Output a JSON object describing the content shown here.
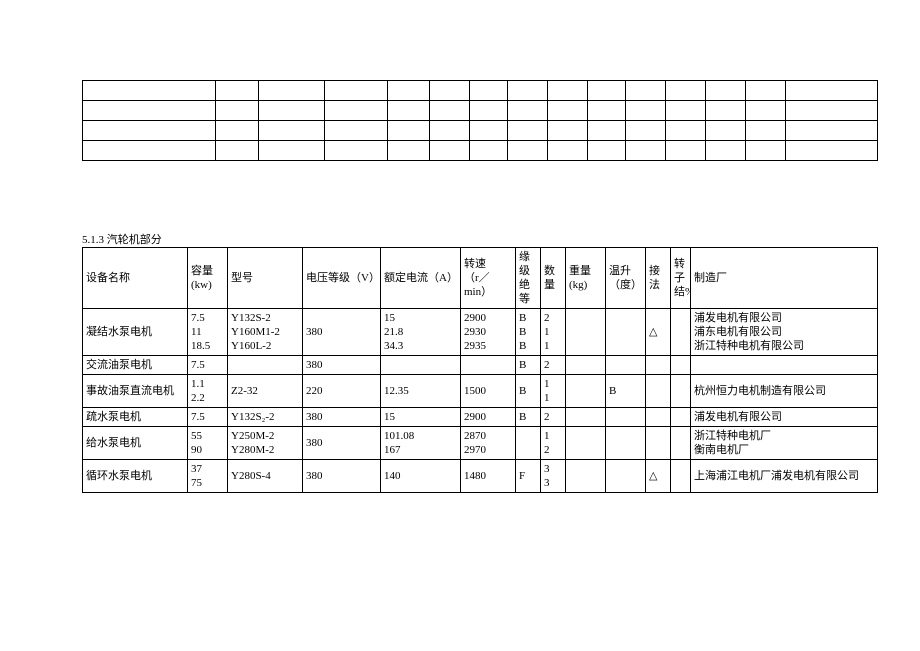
{
  "section_title": "5.1.3 汽轮机部分",
  "headers": {
    "name": "设备名称",
    "capacity": "容量\n(kw)",
    "model": "型号",
    "voltage": "电压等级（V）",
    "current": "额定电流（A）",
    "speed": "转速\n（r／min）",
    "insulation": "缘级绝等",
    "qty": "数量",
    "weight": "重量\n(kg)",
    "temp": "温升\n（度）",
    "conn": "接法",
    "rotor": "转子结%",
    "mfr": "制造厂"
  },
  "rows": [
    {
      "name": "凝结水泵电机",
      "capacity": [
        "7.5",
        "11",
        "18.5"
      ],
      "model": [
        "Y132S-2",
        "Y160M1-2",
        "Y160L-2"
      ],
      "voltage": "380",
      "current": [
        "15",
        "21.8",
        "34.3"
      ],
      "speed": [
        "2900",
        "2930",
        "2935"
      ],
      "insulation": [
        "B",
        "B",
        "B"
      ],
      "qty": [
        "2",
        "1",
        "1"
      ],
      "weight": "",
      "temp": "",
      "conn": "△",
      "rotor": "",
      "mfr": [
        "浦发电机有限公司",
        "浦东电机有限公司",
        "浙江特种电机有限公司"
      ]
    },
    {
      "name": "交流油泵电机",
      "capacity": [
        "7.5"
      ],
      "model": [
        ""
      ],
      "voltage": "380",
      "current": [
        ""
      ],
      "speed": [
        ""
      ],
      "insulation": [
        "B"
      ],
      "qty": [
        "2"
      ],
      "weight": "",
      "temp": "",
      "conn": "",
      "rotor": "",
      "mfr": [
        ""
      ]
    },
    {
      "name": "事故油泵直流电机",
      "capacity": [
        "1.1",
        "2.2"
      ],
      "model": [
        "",
        "Z2-32"
      ],
      "voltage": "220",
      "current": [
        "",
        "12.35"
      ],
      "speed": [
        "",
        "1500"
      ],
      "insulation": [
        "B"
      ],
      "qty": [
        "1",
        "1"
      ],
      "weight": "",
      "temp": "B",
      "conn": "",
      "rotor": "",
      "mfr": [
        "杭州恒力电机制造有限公司"
      ]
    },
    {
      "name": "疏水泵电机",
      "capacity": [
        "7.5"
      ],
      "model": [
        "Y132S₂-2"
      ],
      "voltage": "380",
      "current": [
        "15"
      ],
      "speed": [
        "2900"
      ],
      "insulation": [
        "B"
      ],
      "qty": [
        "2"
      ],
      "weight": "",
      "temp": "",
      "conn": "",
      "rotor": "",
      "mfr": [
        "浦发电机有限公司"
      ]
    },
    {
      "name": "给水泵电机",
      "capacity": [
        "55",
        "90"
      ],
      "model": [
        "Y250M-2",
        "Y280M-2"
      ],
      "voltage": "380",
      "current": [
        "101.08",
        "167"
      ],
      "speed": [
        "2870",
        "2970"
      ],
      "insulation": [
        ""
      ],
      "qty": [
        "1",
        "2"
      ],
      "weight": "",
      "temp": "",
      "conn": "",
      "rotor": "",
      "mfr": [
        "浙江特种电机厂",
        "衡南电机厂"
      ]
    },
    {
      "name": "循环水泵电机",
      "capacity": [
        "37",
        "75"
      ],
      "model": [
        "",
        "Y280S-4"
      ],
      "voltage": "380",
      "current": [
        "",
        "140"
      ],
      "speed": [
        "",
        "1480"
      ],
      "insulation": [
        "F"
      ],
      "qty": [
        "3",
        "3"
      ],
      "weight": "",
      "temp": "",
      "conn": "△",
      "rotor": "",
      "mfr": [
        "上海浦江电机厂浦发电机有限公司"
      ]
    }
  ],
  "chart_data": {
    "type": "table",
    "title": "5.1.3 汽轮机部分",
    "columns": [
      "设备名称",
      "容量(kw)",
      "型号",
      "电压等级(V)",
      "额定电流(A)",
      "转速(r/min)",
      "缘级绝等",
      "数量",
      "重量(kg)",
      "温升(度)",
      "接法",
      "转子结%",
      "制造厂"
    ],
    "data": [
      [
        "凝结水泵电机",
        "7.5",
        "Y132S-2",
        "380",
        "15",
        "2900",
        "B",
        "2",
        "",
        "",
        "△",
        "",
        "浦发电机有限公司"
      ],
      [
        "凝结水泵电机",
        "11",
        "Y160M1-2",
        "380",
        "21.8",
        "2930",
        "B",
        "1",
        "",
        "",
        "△",
        "",
        "浦东电机有限公司"
      ],
      [
        "凝结水泵电机",
        "18.5",
        "Y160L-2",
        "380",
        "34.3",
        "2935",
        "B",
        "1",
        "",
        "",
        "△",
        "",
        "浙江特种电机有限公司"
      ],
      [
        "交流油泵电机",
        "7.5",
        "",
        "380",
        "",
        "",
        "B",
        "2",
        "",
        "",
        "",
        "",
        ""
      ],
      [
        "事故油泵直流电机",
        "1.1",
        "",
        "220",
        "",
        "",
        "B",
        "1",
        "",
        "B",
        "",
        "",
        "杭州恒力电机制造有限公司"
      ],
      [
        "事故油泵直流电机",
        "2.2",
        "Z2-32",
        "220",
        "12.35",
        "1500",
        "B",
        "1",
        "",
        "B",
        "",
        "",
        "杭州恒力电机制造有限公司"
      ],
      [
        "疏水泵电机",
        "7.5",
        "Y132S₂-2",
        "380",
        "15",
        "2900",
        "B",
        "2",
        "",
        "",
        "",
        "",
        "浦发电机有限公司"
      ],
      [
        "给水泵电机",
        "55",
        "Y250M-2",
        "380",
        "101.08",
        "2870",
        "",
        "1",
        "",
        "",
        "",
        "",
        "浙江特种电机厂"
      ],
      [
        "给水泵电机",
        "90",
        "Y280M-2",
        "380",
        "167",
        "2970",
        "",
        "2",
        "",
        "",
        "",
        "",
        "衡南电机厂"
      ],
      [
        "循环水泵电机",
        "37",
        "",
        "380",
        "",
        "",
        "F",
        "3",
        "",
        "",
        "△",
        "",
        "上海浦江电机厂浦发电机有限公司"
      ],
      [
        "循环水泵电机",
        "75",
        "Y280S-4",
        "380",
        "140",
        "1480",
        "F",
        "3",
        "",
        "",
        "△",
        "",
        "上海浦江电机厂浦发电机有限公司"
      ]
    ]
  }
}
